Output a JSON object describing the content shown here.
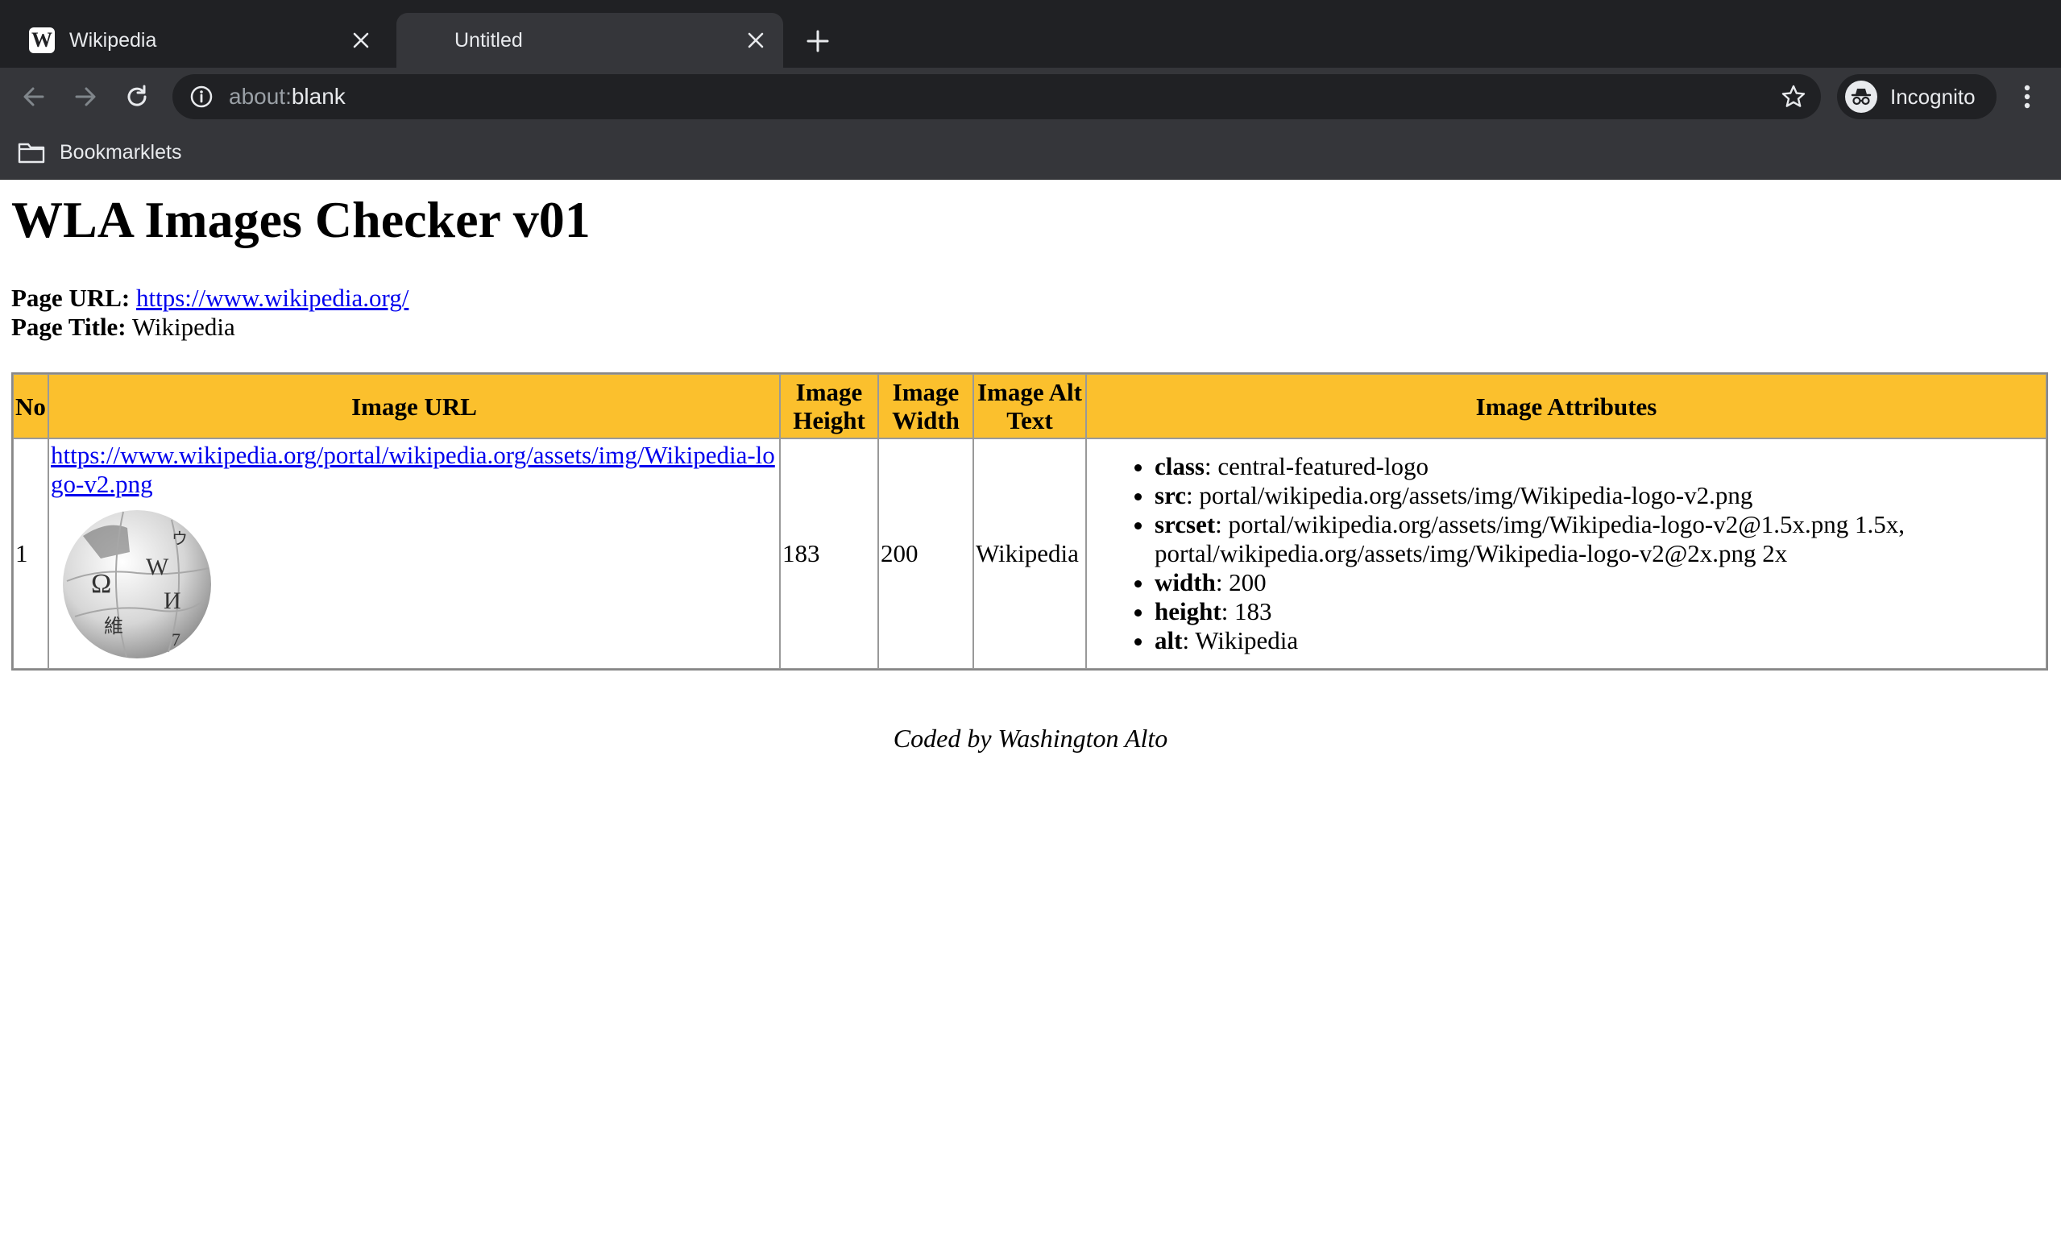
{
  "browser": {
    "tabs": [
      {
        "title": "Wikipedia",
        "favicon": "W",
        "active": false
      },
      {
        "title": "Untitled",
        "active": true
      }
    ],
    "address": {
      "scheme": "about:",
      "rest": "blank"
    },
    "profile_label": "Incognito",
    "bookmarks": [
      {
        "label": "Bookmarklets",
        "icon": "folder-icon"
      }
    ]
  },
  "page": {
    "heading": "WLA Images Checker v01",
    "url_label": "Page URL:",
    "url_value": "https://www.wikipedia.org/",
    "title_label": "Page Title:",
    "title_value": "Wikipedia",
    "table": {
      "headers": [
        "No",
        "Image URL",
        "Image Height",
        "Image Width",
        "Image Alt Text",
        "Image Attributes"
      ],
      "rows": [
        {
          "no": "1",
          "image_url": "https://www.wikipedia.org/portal/wikipedia.org/assets/img/Wikipedia-logo-v2.png",
          "height": "183",
          "width": "200",
          "alt": "Wikipedia",
          "attributes": [
            {
              "name": "class",
              "value": ": central-featured-logo"
            },
            {
              "name": "src",
              "value": ": portal/wikipedia.org/assets/img/Wikipedia-logo-v2.png"
            },
            {
              "name": "srcset",
              "value": ": portal/wikipedia.org/assets/img/Wikipedia-logo-v2@1.5x.png 1.5x, portal/wikipedia.org/assets/img/Wikipedia-logo-v2@2x.png 2x"
            },
            {
              "name": "width",
              "value": ": 200"
            },
            {
              "name": "height",
              "value": ": 183"
            },
            {
              "name": "alt",
              "value": ": Wikipedia"
            }
          ]
        }
      ]
    },
    "footer": "Coded by Washington Alto"
  },
  "colors": {
    "header_bg": "#fbc02d",
    "link": "#0000ee",
    "chrome_dark": "#202124",
    "chrome_toolbar": "#35363a"
  }
}
